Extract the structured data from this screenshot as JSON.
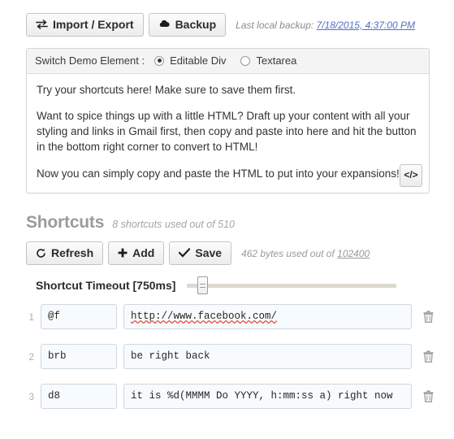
{
  "toolbar": {
    "import_export_label": "Import / Export",
    "import_export_icon": "transfer-arrows-icon",
    "backup_label": "Backup",
    "backup_icon": "cloud-upload-icon",
    "last_backup_prefix": "Last local backup:",
    "last_backup_time": "7/18/2015, 4:37:00 PM",
    "link_color": "#4f70c4"
  },
  "demo": {
    "switch_label": "Switch Demo Element :",
    "options": [
      {
        "label": "Editable Div",
        "selected": true
      },
      {
        "label": "Textarea",
        "selected": false
      }
    ],
    "paragraphs": [
      "Try your shortcuts here! Make sure to save them first.",
      "Want to spice things up with a little HTML? Draft up your content with all your styling and links in Gmail first, then copy and paste into here and hit the button in the bottom right corner to convert to HTML!",
      "Now you can simply copy and paste the HTML to put into your expansions!"
    ],
    "code_button_label": "</>",
    "code_button_icon": "code-brackets-icon"
  },
  "shortcuts": {
    "title": "Shortcuts",
    "usage_note": "8 shortcuts used out of 510",
    "refresh_label": "Refresh",
    "refresh_icon": "refresh-icon",
    "add_label": "Add",
    "add_icon": "plus-icon",
    "save_label": "Save",
    "save_icon": "check-icon",
    "bytes_prefix": "462 bytes used out of",
    "bytes_total": "102400",
    "timeout_label": "Shortcut Timeout [750ms]",
    "timeout_value_ms": 750,
    "delete_icon": "trash-icon",
    "rows": [
      {
        "num": "1",
        "key": "@f",
        "value": "http://www.facebook.com/",
        "spellcheck_error": true
      },
      {
        "num": "2",
        "key": "brb",
        "value": "be right back",
        "spellcheck_error": false
      },
      {
        "num": "3",
        "key": "d8",
        "value": "it is %d(MMMM Do YYYY, h:mm:ss a) right now",
        "spellcheck_error": false
      }
    ]
  }
}
